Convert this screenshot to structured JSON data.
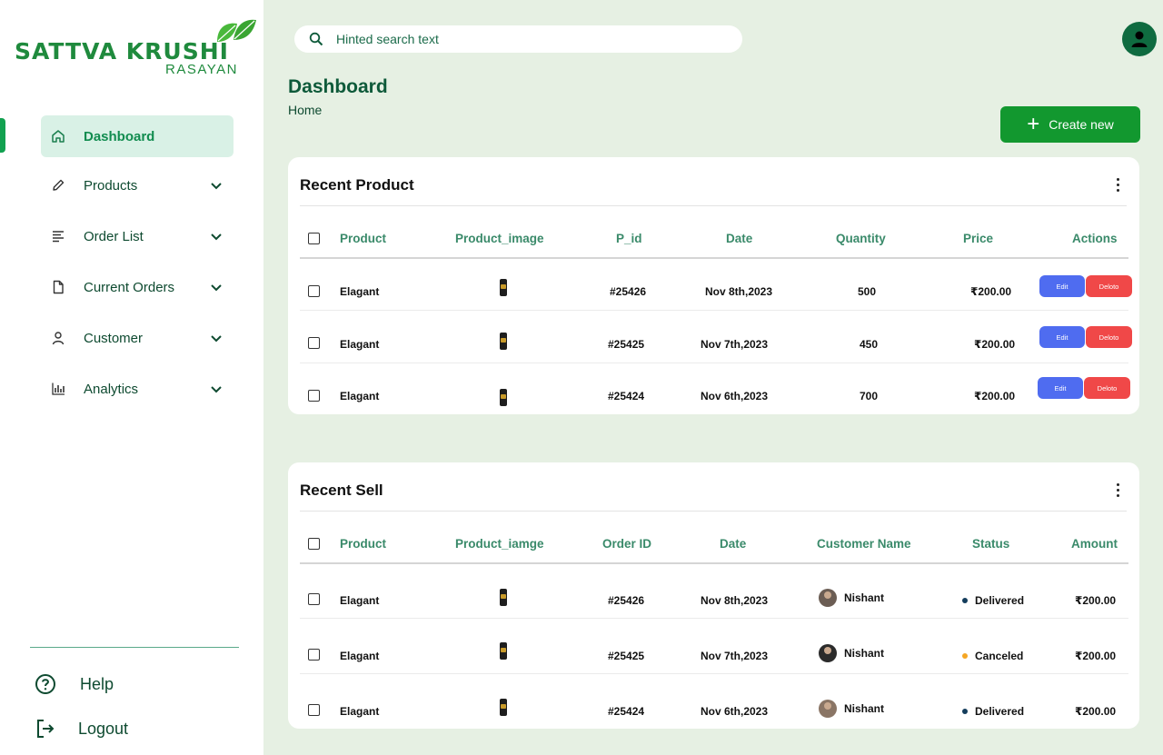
{
  "brand": {
    "name": "SATTVA KRUSHI",
    "sub": "RASAYAN"
  },
  "sidebar": {
    "items": [
      {
        "label": "Dashboard",
        "icon": "home-icon",
        "active": true
      },
      {
        "label": "Products",
        "icon": "pencil-icon"
      },
      {
        "label": "Order List",
        "icon": "list-icon"
      },
      {
        "label": "Current Orders",
        "icon": "document-icon"
      },
      {
        "label": "Customer",
        "icon": "user-icon"
      },
      {
        "label": "Analytics",
        "icon": "bar-chart-icon"
      }
    ],
    "help": "Help",
    "logout": "Logout"
  },
  "search": {
    "placeholder": "Hinted search text"
  },
  "header": {
    "title": "Dashboard",
    "breadcrumb": "Home",
    "create_label": "Create new"
  },
  "recent_product": {
    "title": "Recent Product",
    "columns": [
      "Product",
      "Product_image",
      "P_id",
      "Date",
      "Quantity",
      "Price",
      "Actions"
    ],
    "rows": [
      {
        "product": "Elagant",
        "pid": "#25426",
        "date": "Nov 8th,2023",
        "quantity": "500",
        "price": "₹200.00",
        "edit": "Edit",
        "delete": "Deloto"
      },
      {
        "product": "Elagant",
        "pid": "#25425",
        "date": "Nov 7th,2023",
        "quantity": "450",
        "price": "₹200.00",
        "edit": "Edit",
        "delete": "Deloto"
      },
      {
        "product": "Elagant",
        "pid": "#25424",
        "date": "Nov 6th,2023",
        "quantity": "700",
        "price": "₹200.00",
        "edit": "Edit",
        "delete": "Deloto"
      }
    ]
  },
  "recent_sell": {
    "title": "Recent Sell",
    "columns": [
      "Product",
      "Product_iamge",
      "Order ID",
      "Date",
      "Customer  Name",
      "Status",
      "Amount"
    ],
    "rows": [
      {
        "product": "Elagant",
        "order_id": "#25426",
        "date": "Nov 8th,2023",
        "customer": "Nishant",
        "status": "Delivered",
        "status_color": "#143d5c",
        "amount": "₹200.00"
      },
      {
        "product": "Elagant",
        "order_id": "#25425",
        "date": "Nov 7th,2023",
        "customer": "Nishant",
        "status": "Canceled",
        "status_color": "#f5a623",
        "amount": "₹200.00"
      },
      {
        "product": "Elagant",
        "order_id": "#25424",
        "date": "Nov 6th,2023",
        "customer": "Nishant",
        "status": "Delivered",
        "status_color": "#143d5c",
        "amount": "₹200.00"
      }
    ]
  },
  "colors": {
    "accent": "#12982f",
    "active_bg": "#d9f1e6",
    "page_bg": "#e6f0e3",
    "edit": "#4f6cf0",
    "delete": "#f04848"
  }
}
